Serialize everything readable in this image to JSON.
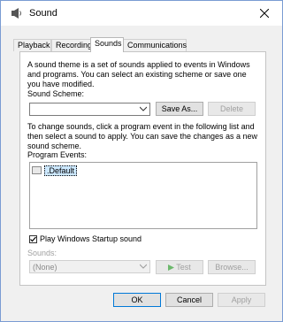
{
  "window": {
    "title": "Sound",
    "icon": "speaker-icon"
  },
  "tabs": [
    {
      "label": "Playback",
      "active": false
    },
    {
      "label": "Recording",
      "active": false
    },
    {
      "label": "Sounds",
      "active": true
    },
    {
      "label": "Communications",
      "active": false
    }
  ],
  "sounds": {
    "intro_text": "A sound theme is a set of sounds applied to events in Windows and programs.  You can select an existing scheme or save one you have modified.",
    "scheme_label": "Sound Scheme:",
    "scheme_value": "",
    "save_as_label": "Save As...",
    "delete_label": "Delete",
    "change_text": "To change sounds, click a program event in the following list and then select a sound to apply.  You can save the changes as a new sound scheme.",
    "events_label": "Program Events:",
    "events": [
      {
        "label": ".Default"
      }
    ],
    "startup_checkbox_label": "Play Windows Startup sound",
    "startup_checked": true,
    "sounds_label": "Sounds:",
    "sound_value": "(None)",
    "test_label": "Test",
    "browse_label": "Browse..."
  },
  "footer": {
    "ok_label": "OK",
    "cancel_label": "Cancel",
    "apply_label": "Apply"
  },
  "colors": {
    "accent": "#0078d7",
    "selection": "#cce8ff",
    "disabled_text": "#a0a0a0"
  }
}
